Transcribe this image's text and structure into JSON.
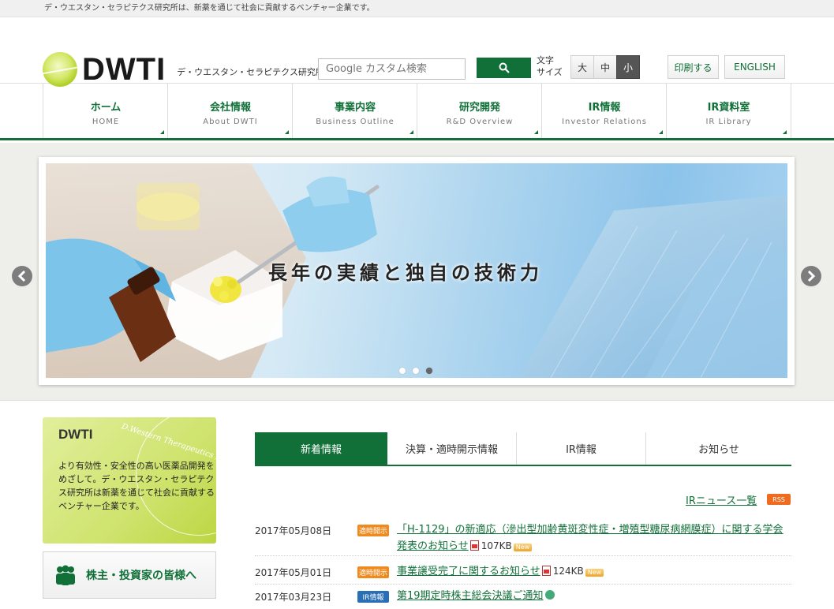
{
  "topbar": {
    "text": "デ・ウエスタン・セラピテクス研究所は、新薬を通じて社会に貢献するベンチャー企業です。"
  },
  "header": {
    "logo_text": "DWTI",
    "logo_sub": "デ・ウエスタン・セラピテクス研究所",
    "search_placeholder": "Google カスタム検索",
    "font_size_label_1": "文字",
    "font_size_label_2": "サイズ",
    "font_sizes": [
      "大",
      "中",
      "小"
    ],
    "print_label": "印刷する",
    "english_label": "ENGLISH"
  },
  "nav": [
    {
      "jp": "ホーム",
      "en": "HOME"
    },
    {
      "jp": "会社情報",
      "en": "About DWTI"
    },
    {
      "jp": "事業内容",
      "en": "Business Outline"
    },
    {
      "jp": "研究開発",
      "en": "R&D Overview"
    },
    {
      "jp": "IR情報",
      "en": "Investor Relations"
    },
    {
      "jp": "IR資料室",
      "en": "IR Library"
    }
  ],
  "hero": {
    "caption": "長年の実績と独自の技術力",
    "active_dot": 3,
    "dot_count": 3
  },
  "sidebar": {
    "box_title": "DWTI",
    "box_script": "D.Western Therapeutics Institute",
    "box_text": "より有効性・安全性の高い医薬品開発をめざして。デ・ウエスタン・セラピテクス研究所は新薬を通じて社会に貢献するベンチャー企業です。",
    "investor_label": "株主・投資家の皆様へ"
  },
  "tabs": [
    "新着情報",
    "決算・適時開示情報",
    "IR情報",
    "お知らせ"
  ],
  "ir_list_link": "IRニュース一覧",
  "rss_label": "RSS",
  "news": [
    {
      "date": "2017年05月08日",
      "badge": "適時開示",
      "title": "「H-1129」の新適応（滲出型加齢黄斑変性症・増殖型糖尿病網膜症）に関する学会発表のお知らせ",
      "size": "107KB",
      "new": "New"
    },
    {
      "date": "2017年05月01日",
      "badge": "適時開示",
      "title": "事業譲受完了に関するお知らせ",
      "size": "124KB",
      "new": "New"
    },
    {
      "date": "2017年03月23日",
      "badge": "IR情報",
      "title": "第19期定時株主総会決議ご通知"
    }
  ],
  "colors": {
    "brand_green": "#107038",
    "badge_orange": "#ef8a1e",
    "badge_blue": "#2a6fb5",
    "rss_orange": "#ef6b1f"
  }
}
